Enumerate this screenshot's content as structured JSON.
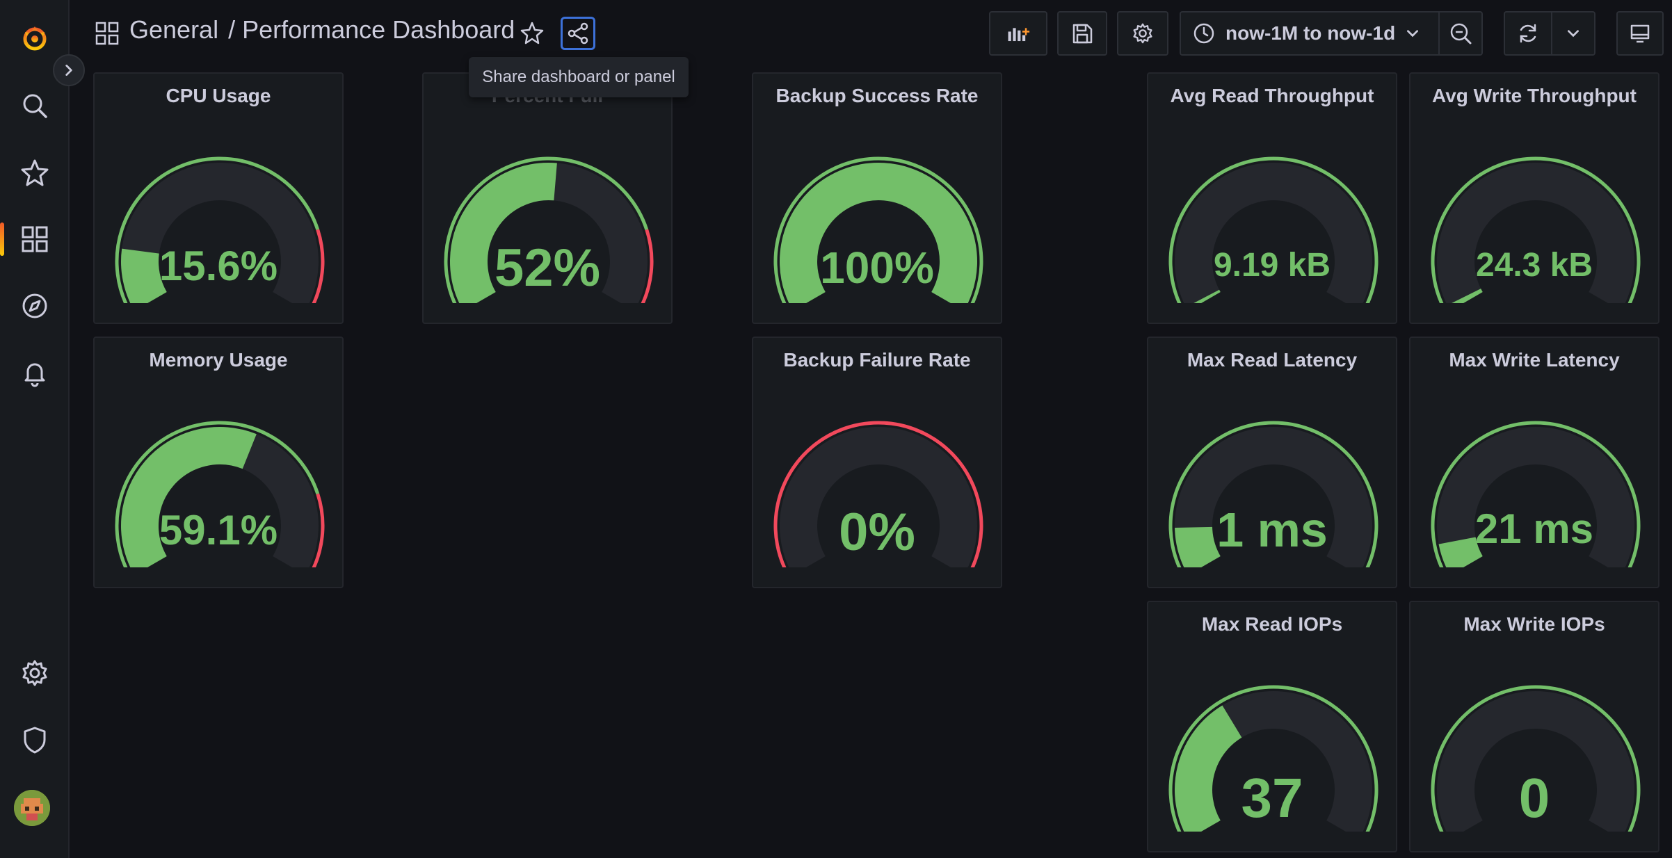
{
  "breadcrumb": {
    "folder": "General",
    "separator": "/",
    "dashboard": "Performance Dashboard"
  },
  "tooltip": {
    "text": "Share dashboard or panel"
  },
  "time_picker": {
    "label": "now-1M to now-1d"
  },
  "colors": {
    "green": "#73bf69",
    "red": "#f2495c",
    "accent": "#3d71d9",
    "track": "#25272d"
  },
  "panels": [
    {
      "title": "CPU Usage",
      "value": "15.6%",
      "fraction": 0.156,
      "outer": "green-red"
    },
    {
      "title": "Percent Full",
      "value": "52%",
      "fraction": 0.52,
      "outer": "green-red"
    },
    {
      "title": "Backup Success Rate",
      "value": "100%",
      "fraction": 1.0,
      "outer": "green"
    },
    {
      "title": "Avg Read Throughput",
      "value": "9.19 kB",
      "fraction": 0.01,
      "outer": "green"
    },
    {
      "title": "Avg Write Throughput",
      "value": "24.3 kB",
      "fraction": 0.015,
      "outer": "green"
    },
    {
      "title": "Memory Usage",
      "value": "59.1%",
      "fraction": 0.591,
      "outer": "green-red"
    },
    {
      "title": "Backup Failure Rate",
      "value": "0%",
      "fraction": 0.0,
      "outer": "red"
    },
    {
      "title": "Max Read Latency",
      "value": "1 ms",
      "fraction": 0.12,
      "outer": "green"
    },
    {
      "title": "Max Write Latency",
      "value": "21 ms",
      "fraction": 0.08,
      "outer": "green"
    },
    {
      "title": "Max Read IOPs",
      "value": "37",
      "fraction": 0.37,
      "outer": "green"
    },
    {
      "title": "Max Write IOPs",
      "value": "0",
      "fraction": 0.0,
      "outer": "green"
    }
  ]
}
